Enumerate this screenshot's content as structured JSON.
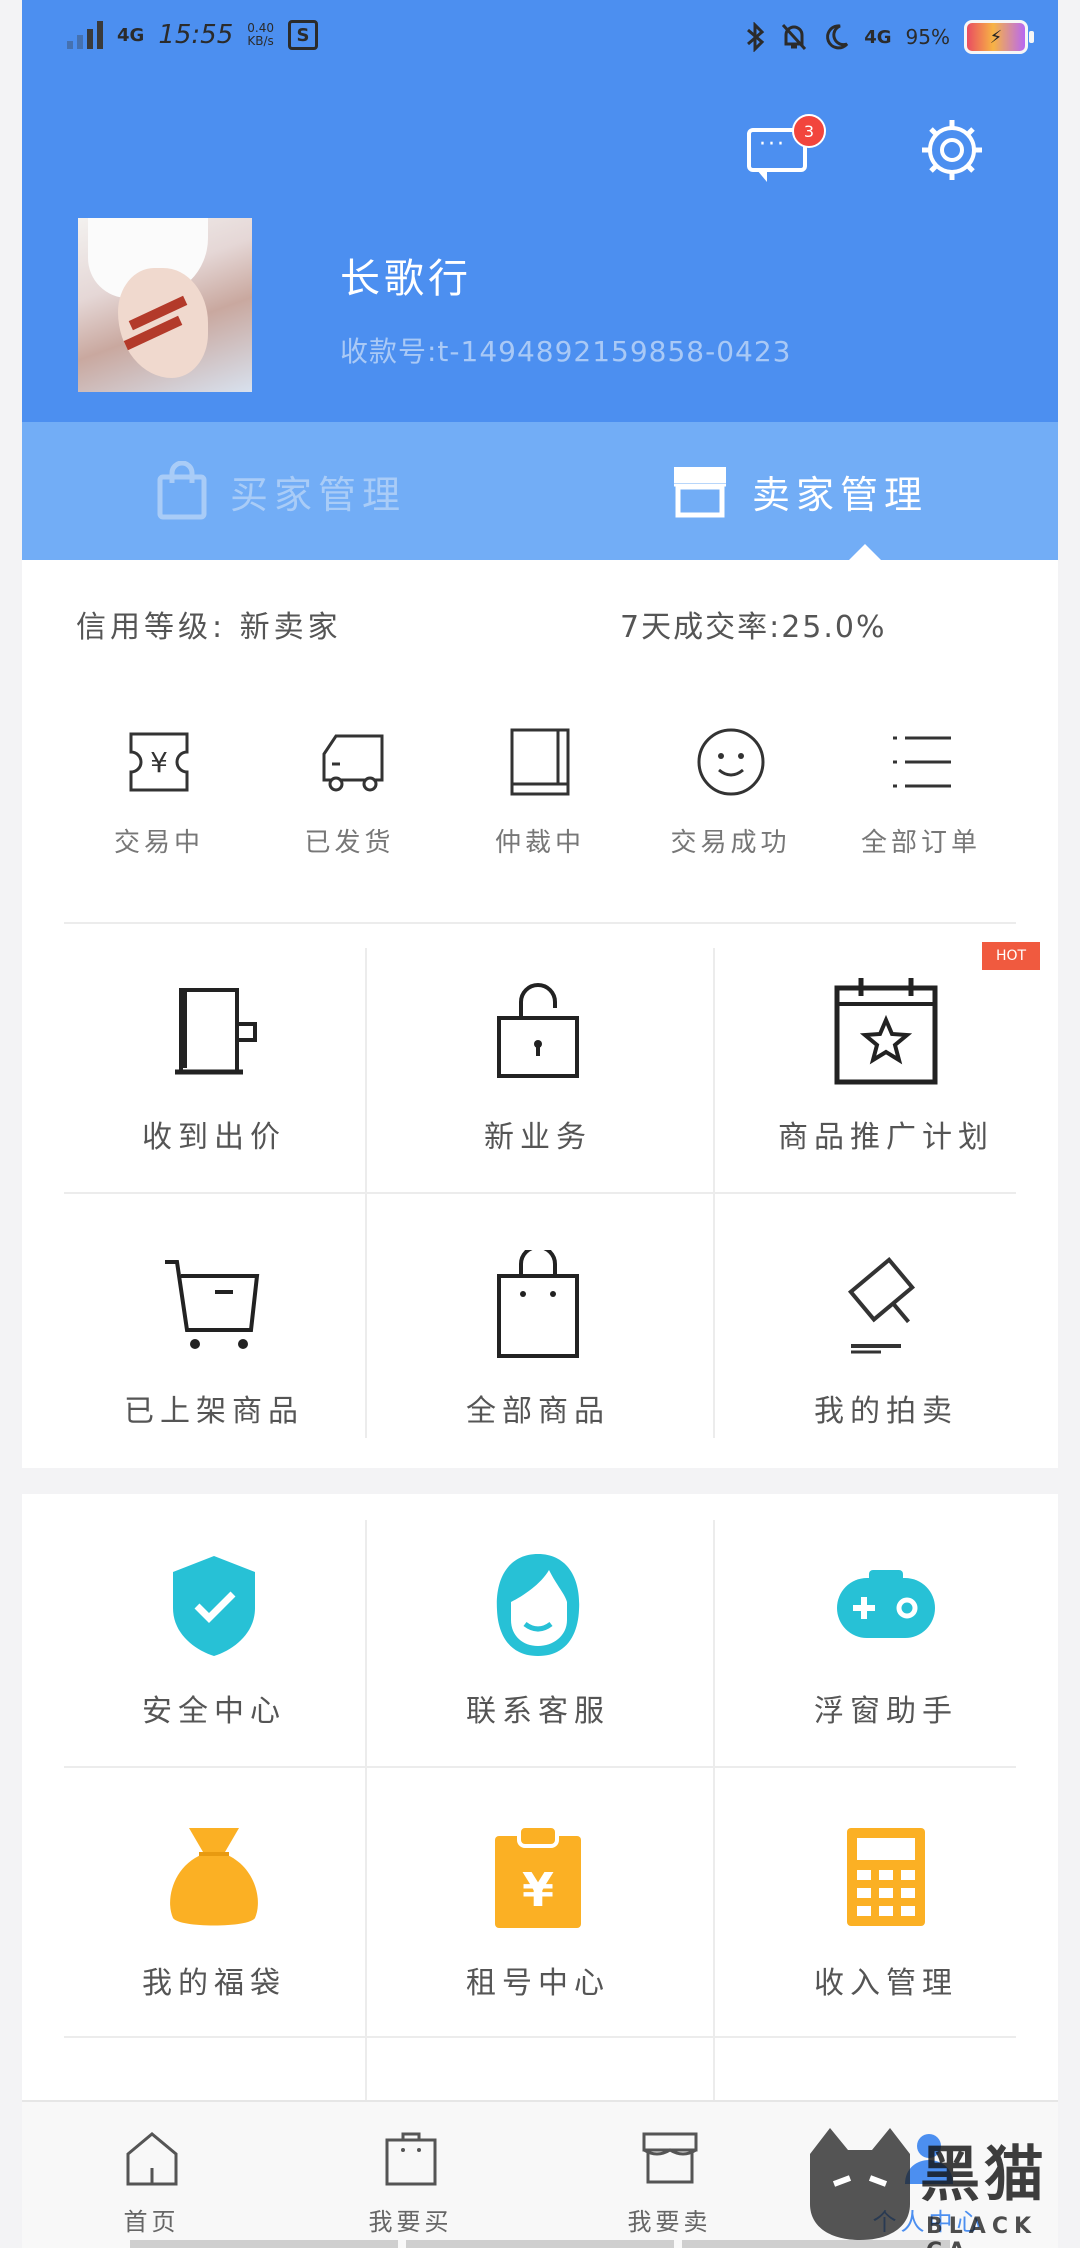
{
  "status_bar": {
    "network": "4G",
    "time": "15:55",
    "speed_value": "0.40",
    "speed_unit": "KB/s",
    "network2": "4G",
    "battery_text": "95%"
  },
  "header": {
    "message_badge": "3",
    "username": "长歌行",
    "account": "收款号:t-1494892159858-0423"
  },
  "tabs": [
    {
      "label": "买家管理",
      "active": false
    },
    {
      "label": "卖家管理",
      "active": true
    }
  ],
  "seller": {
    "credit_label": "信用等级:",
    "credit_value": "新卖家",
    "rate_text": "7天成交率:25.0%"
  },
  "orders": [
    {
      "label": "交易中",
      "icon": "yuan-ticket-icon"
    },
    {
      "label": "已发货",
      "icon": "truck-icon"
    },
    {
      "label": "仲裁中",
      "icon": "book-icon"
    },
    {
      "label": "交易成功",
      "icon": "smile-icon"
    },
    {
      "label": "全部订单",
      "icon": "list-icon"
    }
  ],
  "services": [
    {
      "label": "收到出价",
      "icon": "mug-icon"
    },
    {
      "label": "新业务",
      "icon": "lock-icon"
    },
    {
      "label": "商品推广计划",
      "icon": "calendar-star-icon"
    },
    {
      "label": "已上架商品",
      "icon": "cart-icon"
    },
    {
      "label": "全部商品",
      "icon": "bag-icon"
    },
    {
      "label": "我的拍卖",
      "icon": "gavel-icon"
    }
  ],
  "hot_badge": "HOT",
  "tools": [
    {
      "label": "安全中心",
      "icon": "shield-check-icon",
      "color": "#27c1d6"
    },
    {
      "label": "联系客服",
      "icon": "support-agent-icon",
      "color": "#27c1d6"
    },
    {
      "label": "浮窗助手",
      "icon": "gamepad-icon",
      "color": "#27c1d6"
    },
    {
      "label": "我的福袋",
      "icon": "lucky-bag-icon",
      "color": "#fbb024"
    },
    {
      "label": "租号中心",
      "icon": "yuan-clipboard-icon",
      "color": "#fbb024"
    },
    {
      "label": "收入管理",
      "icon": "calculator-icon",
      "color": "#fbb024"
    }
  ],
  "bottom_nav": [
    {
      "label": "首页",
      "icon": "home-icon"
    },
    {
      "label": "我要买",
      "icon": "shopping-bag-icon"
    },
    {
      "label": "我要卖",
      "icon": "store-icon"
    },
    {
      "label": "个人中心",
      "icon": "person-icon",
      "active": true
    }
  ],
  "watermark": {
    "main": "黑猫",
    "sub": "BLACK CA"
  },
  "colors": {
    "brand_blue": "#4c8ff0",
    "tab_bar": "#72adf6",
    "cyan": "#27c1d6",
    "amber": "#fbb024",
    "hot_red": "#f05a3f"
  }
}
